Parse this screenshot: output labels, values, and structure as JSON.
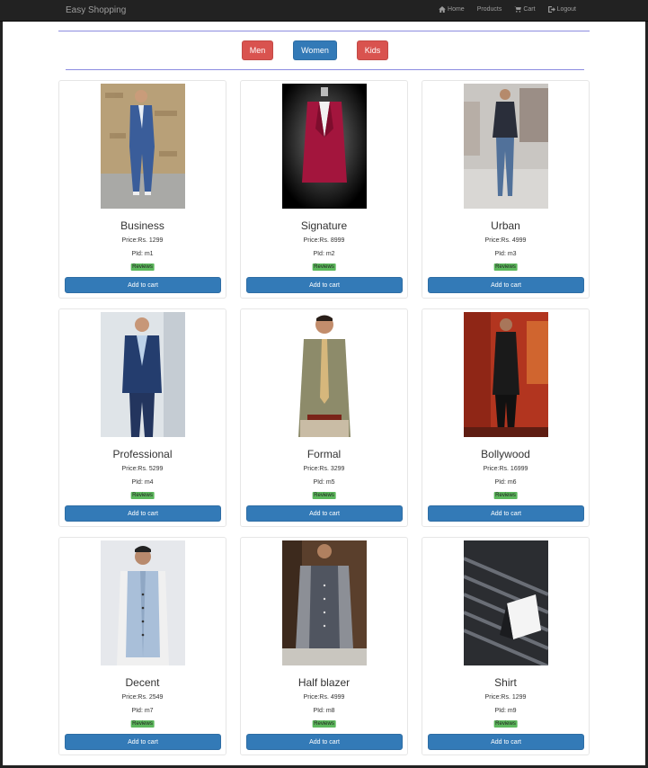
{
  "navbar": {
    "brand": "Easy Shopping",
    "links": [
      {
        "label": "Home",
        "icon": "home-icon"
      },
      {
        "label": "Products",
        "icon": ""
      },
      {
        "label": "Cart",
        "icon": "cart-icon"
      },
      {
        "label": "Logout",
        "icon": "logout-icon"
      }
    ]
  },
  "categories": {
    "men": "Men",
    "women": "Women",
    "kids": "Kids"
  },
  "colors": {
    "danger": "#d9534f",
    "primary": "#337ab7",
    "success": "#5cb85c",
    "navbar": "#222222"
  },
  "products": [
    {
      "name": "Business",
      "price": "Price:Rs. 1299",
      "pid": "PId: m1",
      "reviews": "Reviews",
      "add": "Add to cart",
      "image": "man-blue-suit-photo"
    },
    {
      "name": "Signature",
      "price": "Price:Rs. 8999",
      "pid": "PId: m2",
      "reviews": "Reviews",
      "add": "Add to cart",
      "image": "maroon-blazer-photo"
    },
    {
      "name": "Urban",
      "price": "Price:Rs. 4999",
      "pid": "PId: m3",
      "reviews": "Reviews",
      "add": "Add to cart",
      "image": "man-jacket-jeans-photo"
    },
    {
      "name": "Professional",
      "price": "Price:Rs. 5299",
      "pid": "PId: m4",
      "reviews": "Reviews",
      "add": "Add to cart",
      "image": "man-navy-suit-photo"
    },
    {
      "name": "Formal",
      "price": "Price:Rs. 3299",
      "pid": "PId: m5",
      "reviews": "Reviews",
      "add": "Add to cart",
      "image": "man-shirt-tie-photo"
    },
    {
      "name": "Bollywood",
      "price": "Price:Rs. 16999",
      "pid": "PId: m6",
      "reviews": "Reviews",
      "add": "Add to cart",
      "image": "man-black-sherwani-photo"
    },
    {
      "name": "Decent",
      "price": "Price:Rs. 2549",
      "pid": "PId: m7",
      "reviews": "Reviews",
      "add": "Add to cart",
      "image": "man-light-vest-photo"
    },
    {
      "name": "Half blazer",
      "price": "Price:Rs. 4999",
      "pid": "PId: m8",
      "reviews": "Reviews",
      "add": "Add to cart",
      "image": "man-grey-vest-photo"
    },
    {
      "name": "Shirt",
      "price": "Price:Rs. 1299",
      "pid": "PId: m9",
      "reviews": "Reviews",
      "add": "Add to cart",
      "image": "folded-shirt-photo"
    }
  ]
}
